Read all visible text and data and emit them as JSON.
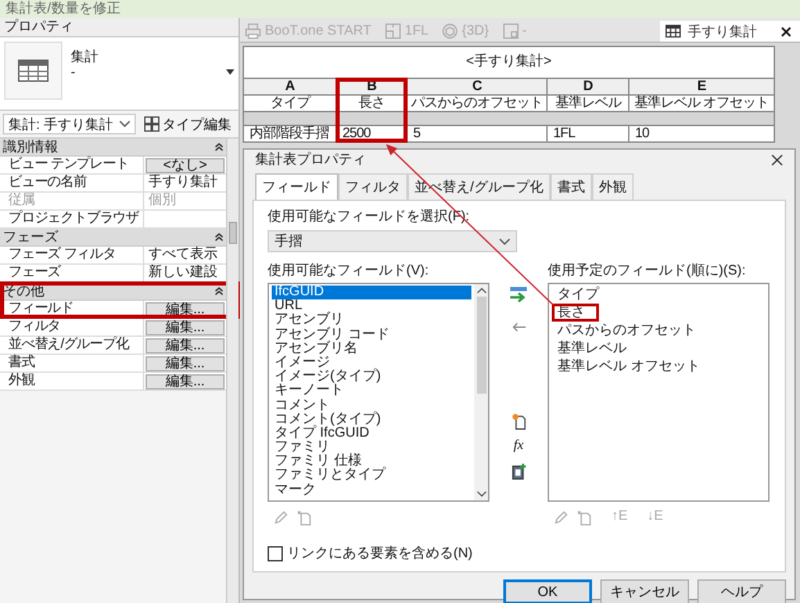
{
  "title_bar": "集計表/数量を修正",
  "properties": {
    "title": "プロパティ",
    "type_name": "集計",
    "type_sub": "-",
    "instance": "集計: 手すり集計",
    "edit_type": "タイプ編集",
    "groups": [
      {
        "name": "識別情報",
        "highlighted": false,
        "rows": [
          {
            "label": "ビュー テンプレート",
            "value": "<なし>",
            "kind": "button",
            "disabled": false
          },
          {
            "label": "ビューの名前",
            "value": "手すり集計",
            "kind": "text",
            "disabled": false
          },
          {
            "label": "従属",
            "value": "個別",
            "kind": "text",
            "disabled": true
          },
          {
            "label": "プロジェクトブラウザ",
            "kind": "text",
            "disabled": false
          }
        ]
      },
      {
        "name": "フェーズ",
        "highlighted": false,
        "rows": [
          {
            "label": "フェーズ フィルタ",
            "value": "すべて表示",
            "kind": "text",
            "disabled": false
          },
          {
            "label": "フェーズ",
            "value": "新しい建設",
            "kind": "text",
            "disabled": false
          }
        ]
      },
      {
        "name": "その他",
        "highlighted": true,
        "rows": [
          {
            "label": "フィールド",
            "value": "編集...",
            "kind": "button",
            "disabled": false
          },
          {
            "label": "フィルタ",
            "value": "編集...",
            "kind": "button",
            "disabled": false
          },
          {
            "label": "並べ替え/グループ化",
            "value": "編集...",
            "kind": "button",
            "disabled": false
          },
          {
            "label": "書式",
            "value": "編集...",
            "kind": "button",
            "disabled": false
          },
          {
            "label": "外観",
            "value": "編集...",
            "kind": "button",
            "disabled": false
          }
        ]
      }
    ]
  },
  "view_tabs": [
    {
      "label": "BooT.one START",
      "selected": false
    },
    {
      "label": "1FL",
      "selected": false
    },
    {
      "label": "{3D}",
      "selected": false
    },
    {
      "label": "-",
      "selected": false
    },
    {
      "label": "手すり集計",
      "selected": true
    }
  ],
  "schedule": {
    "title": "<手すり集計>",
    "columns": [
      {
        "letter": "A",
        "heading": "タイプ",
        "highlighted": false
      },
      {
        "letter": "B",
        "heading": "長さ",
        "highlighted": true
      },
      {
        "letter": "C",
        "heading": "パスからのオフセット",
        "highlighted": false
      },
      {
        "letter": "D",
        "heading": "基準レベル",
        "highlighted": false
      },
      {
        "letter": "E",
        "heading": "基準レベル オフセット",
        "highlighted": false
      }
    ],
    "rows": [
      [
        "内部階段手摺",
        "2500",
        "5",
        "1FL",
        "10"
      ]
    ]
  },
  "dialog": {
    "title": "集計表プロパティ",
    "tabs": [
      {
        "label": "フィールド",
        "selected": true
      },
      {
        "label": "フィルタ",
        "selected": false
      },
      {
        "label": "並べ替え/グループ化",
        "selected": false
      },
      {
        "label": "書式",
        "selected": false
      },
      {
        "label": "外観",
        "selected": false
      }
    ],
    "select_label": "使用可能なフィールドを選択(F):",
    "category": "手摺",
    "available_label": "使用可能なフィールド(V):",
    "available": [
      {
        "label": "IfcGUID",
        "selected": true
      },
      {
        "label": "URL",
        "selected": false
      },
      {
        "label": "アセンブリ",
        "selected": false
      },
      {
        "label": "アセンブリ コード",
        "selected": false
      },
      {
        "label": "アセンブリ名",
        "selected": false
      },
      {
        "label": "イメージ",
        "selected": false
      },
      {
        "label": "イメージ(タイプ)",
        "selected": false
      },
      {
        "label": "キーノート",
        "selected": false
      },
      {
        "label": "コメント",
        "selected": false
      },
      {
        "label": "コメント(タイプ)",
        "selected": false
      },
      {
        "label": "タイプ IfcGUID",
        "selected": false
      },
      {
        "label": "ファミリ",
        "selected": false
      },
      {
        "label": "ファミリ 仕様",
        "selected": false
      },
      {
        "label": "ファミリとタイプ",
        "selected": false
      },
      {
        "label": "マーク",
        "selected": false
      }
    ],
    "middle_tools": [
      {
        "kind": "add"
      },
      {
        "kind": "remove"
      },
      {
        "kind": "new_parameter"
      },
      {
        "kind": "calculated",
        "glyph": "fx"
      },
      {
        "kind": "combine"
      }
    ],
    "left_tools": [
      {
        "kind": "edit",
        "disabled": true
      },
      {
        "kind": "delete",
        "disabled": true
      }
    ],
    "scheduled_label": "使用予定のフィールド(順に)(S):",
    "scheduled": [
      {
        "label": "タイプ",
        "highlighted": false
      },
      {
        "label": "長さ",
        "highlighted": true
      },
      {
        "label": "パスからのオフセット",
        "highlighted": false
      },
      {
        "label": "基準レベル",
        "highlighted": false
      },
      {
        "label": "基準レベル オフセット",
        "highlighted": false
      }
    ],
    "right_tools": [
      {
        "kind": "edit",
        "disabled": true
      },
      {
        "kind": "delete",
        "disabled": true
      },
      {
        "kind": "move",
        "glyph": "↑E",
        "disabled": true
      },
      {
        "kind": "move",
        "glyph": "↓E",
        "disabled": true
      }
    ],
    "include_links": {
      "label": "リンクにある要素を含める(N)",
      "checked": false
    },
    "buttons": [
      {
        "label": "OK",
        "default": true
      },
      {
        "label": "キャンセル",
        "default": false
      },
      {
        "label": "ヘルプ",
        "default": false
      }
    ]
  },
  "annotation_arrow": true
}
